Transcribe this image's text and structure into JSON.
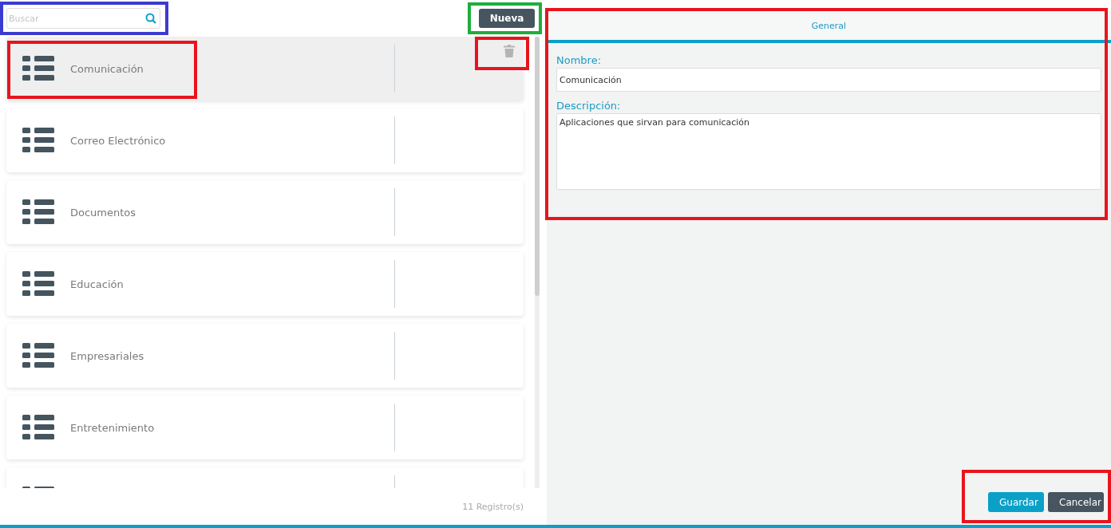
{
  "search": {
    "placeholder": "Buscar",
    "color": "#3b3bd0"
  },
  "new_button": {
    "label": "Nueva",
    "color": "#1fae3c"
  },
  "items": [
    {
      "label": "Comunicación",
      "selected": true,
      "color": "#e8141d",
      "delete_frame": {
        "color": "#e8141d"
      }
    },
    {
      "label": "Correo Electrónico",
      "selected": false
    },
    {
      "label": "Documentos",
      "selected": false
    },
    {
      "label": "Educación",
      "selected": false
    },
    {
      "label": "Empresariales",
      "selected": false
    },
    {
      "label": "Entretenimiento",
      "selected": false
    },
    {
      "selected": false
    }
  ],
  "record_count": "11 Registro(s)",
  "form": {
    "color": "#e8141d",
    "tab": "General",
    "name_label": "Nombre:",
    "name_value": "Comunicación",
    "description_label": "Descripción:",
    "description_value": "Aplicaciones que sirvan para comunicación"
  },
  "actions": {
    "color": "#e8141d",
    "save": "Guardar",
    "cancel": "Cancelar"
  }
}
